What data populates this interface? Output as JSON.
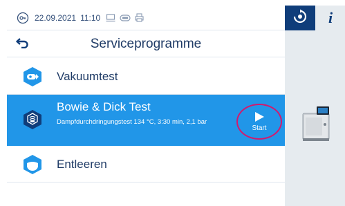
{
  "status": {
    "date": "22.09.2021",
    "time": "11:10"
  },
  "rail": {
    "info_label": "i"
  },
  "header": {
    "title": "Serviceprogramme"
  },
  "programs": [
    {
      "label": "Vakuumtest"
    },
    {
      "label": "Bowie & Dick Test",
      "description": "Dampfdurchdringungstest 134 °C, 3:30 min, 2,1 bar",
      "action": "Start"
    },
    {
      "label": "Entleeren"
    }
  ],
  "colors": {
    "accent_blue": "#2196e8",
    "navy": "#0f3d7a",
    "highlight_circle": "#d11a6e",
    "rail_bg": "#e6ebef"
  },
  "icons": {
    "status": [
      "operator-icon",
      "monitor-icon",
      "card-icon",
      "printer-icon"
    ],
    "rail": [
      "program-mode-icon"
    ],
    "back": "back-arrow-icon",
    "programs": [
      "vacuum-test-icon",
      "bowie-dick-icon",
      "drain-icon"
    ],
    "start": "play-icon"
  }
}
